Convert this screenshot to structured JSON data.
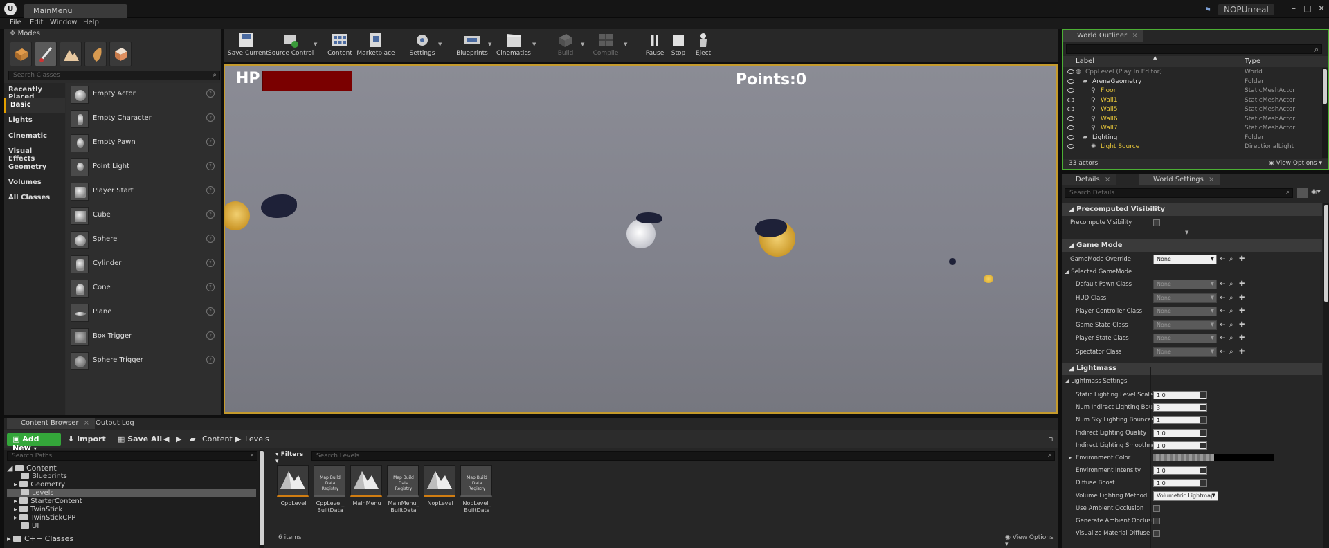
{
  "title_bar": {
    "document_tab": "MainMenu",
    "project_name": "NOPUnreal"
  },
  "menu": [
    "File",
    "Edit",
    "Window",
    "Help"
  ],
  "modes": {
    "tab_label": "Modes",
    "search_placeholder": "Search Classes",
    "categories": [
      "Recently Placed",
      "Basic",
      "Lights",
      "Cinematic",
      "Visual Effects",
      "Geometry",
      "Volumes",
      "All Classes"
    ],
    "selected_category": "Basic",
    "items": [
      "Empty Actor",
      "Empty Character",
      "Empty Pawn",
      "Point Light",
      "Player Start",
      "Cube",
      "Sphere",
      "Cylinder",
      "Cone",
      "Plane",
      "Box Trigger",
      "Sphere Trigger"
    ]
  },
  "toolbar": {
    "buttons": [
      {
        "label": "Save Current",
        "icon": "save-icon",
        "enabled": true
      },
      {
        "label": "Source Control",
        "icon": "source-control-icon",
        "enabled": true
      },
      {
        "label": "Content",
        "icon": "content-icon",
        "enabled": true
      },
      {
        "label": "Marketplace",
        "icon": "marketplace-icon",
        "enabled": true
      },
      {
        "label": "Settings",
        "icon": "settings-icon",
        "enabled": true
      },
      {
        "label": "Blueprints",
        "icon": "blueprints-icon",
        "enabled": true
      },
      {
        "label": "Cinematics",
        "icon": "cinematics-icon",
        "enabled": true
      },
      {
        "label": "Build",
        "icon": "build-icon",
        "enabled": false
      },
      {
        "label": "Compile",
        "icon": "compile-icon",
        "enabled": false
      },
      {
        "label": "Pause",
        "icon": "pause-icon",
        "enabled": true
      },
      {
        "label": "Stop",
        "icon": "stop-icon",
        "enabled": true
      },
      {
        "label": "Eject",
        "icon": "eject-icon",
        "enabled": true
      }
    ]
  },
  "viewport": {
    "hp_label": "HP",
    "points_label": "Points:0",
    "colors": {
      "hp_bar": "#7a0000",
      "border": "#c49a2c"
    }
  },
  "content_browser": {
    "tabs": [
      "Content Browser",
      "Output Log"
    ],
    "add_new": "Add New",
    "import": "Import",
    "save_all": "Save All",
    "breadcrumb": [
      "Content",
      "Levels"
    ],
    "search_paths_placeholder": "Search Paths",
    "filters_label": "Filters",
    "search_levels_placeholder": "Search Levels",
    "tree": [
      {
        "label": "Content",
        "depth": 0
      },
      {
        "label": "Blueprints",
        "depth": 1
      },
      {
        "label": "Geometry",
        "depth": 1
      },
      {
        "label": "Levels",
        "depth": 1
      },
      {
        "label": "StarterContent",
        "depth": 1
      },
      {
        "label": "TwinStick",
        "depth": 1
      },
      {
        "label": "TwinStickCPP",
        "depth": 1
      },
      {
        "label": "UI",
        "depth": 1
      },
      {
        "label": "C++ Classes",
        "depth": 0
      }
    ],
    "assets": [
      {
        "name": "CppLevel",
        "kind": "level"
      },
      {
        "name": "CppLevel_\nBuiltData",
        "kind": "data"
      },
      {
        "name": "MainMenu",
        "kind": "level"
      },
      {
        "name": "MainMenu_\nBuiltData",
        "kind": "data"
      },
      {
        "name": "NopLevel",
        "kind": "level"
      },
      {
        "name": "NopLevel_\nBuiltData",
        "kind": "data"
      }
    ],
    "data_thumb_label": "Map Build\nData Registry",
    "items_count": "6 items",
    "view_options": "View Options"
  },
  "world_outliner": {
    "tab_label": "World Outliner",
    "col_label": "Label",
    "col_type": "Type",
    "rows": [
      {
        "label": "CppLevel (Play In Editor)",
        "type": "World"
      },
      {
        "label": "ArenaGeometry",
        "type": "Folder"
      },
      {
        "label": "Floor",
        "type": "StaticMeshActor"
      },
      {
        "label": "Wall1",
        "type": "StaticMeshActor"
      },
      {
        "label": "Wall5",
        "type": "StaticMeshActor"
      },
      {
        "label": "Wall6",
        "type": "StaticMeshActor"
      },
      {
        "label": "Wall7",
        "type": "StaticMeshActor"
      },
      {
        "label": "Lighting",
        "type": "Folder"
      },
      {
        "label": "Light Source",
        "type": "DirectionalLight"
      }
    ],
    "actors_count": "33 actors",
    "view_options": "View Options"
  },
  "details": {
    "tabs": [
      "Details",
      "World Settings"
    ],
    "search_placeholder": "Search Details",
    "precomputed_visibility": {
      "title": "Precomputed Visibility",
      "precompute_label": "Precompute Visibility"
    },
    "game_mode": {
      "title": "Game Mode",
      "override_label": "GameMode Override",
      "override_value": "None",
      "selected_label": "Selected GameMode",
      "classes": [
        {
          "label": "Default Pawn Class",
          "value": "None"
        },
        {
          "label": "HUD Class",
          "value": "None"
        },
        {
          "label": "Player Controller Class",
          "value": "None"
        },
        {
          "label": "Game State Class",
          "value": "None"
        },
        {
          "label": "Player State Class",
          "value": "None"
        },
        {
          "label": "Spectator Class",
          "value": "None"
        }
      ]
    },
    "lightmass": {
      "title": "Lightmass",
      "settings_label": "Lightmass Settings",
      "rows": [
        {
          "label": "Static Lighting Level Scale",
          "value": "1.0",
          "kind": "num"
        },
        {
          "label": "Num Indirect Lighting Bounces",
          "value": "3",
          "kind": "num"
        },
        {
          "label": "Num Sky Lighting Bounces",
          "value": "1",
          "kind": "num"
        },
        {
          "label": "Indirect Lighting Quality",
          "value": "1.0",
          "kind": "num"
        },
        {
          "label": "Indirect Lighting Smoothness",
          "value": "1.0",
          "kind": "num"
        },
        {
          "label": "Environment Color",
          "value": "",
          "kind": "color"
        },
        {
          "label": "Environment Intensity",
          "value": "1.0",
          "kind": "num"
        },
        {
          "label": "Diffuse Boost",
          "value": "1.0",
          "kind": "num"
        },
        {
          "label": "Volume Lighting Method",
          "value": "Volumetric Lightmap",
          "kind": "drop"
        },
        {
          "label": "Use Ambient Occlusion",
          "value": "",
          "kind": "chk"
        },
        {
          "label": "Generate Ambient Occlusion",
          "value": "",
          "kind": "chk"
        },
        {
          "label": "Visualize Material Diffuse",
          "value": "",
          "kind": "chk"
        }
      ]
    }
  }
}
